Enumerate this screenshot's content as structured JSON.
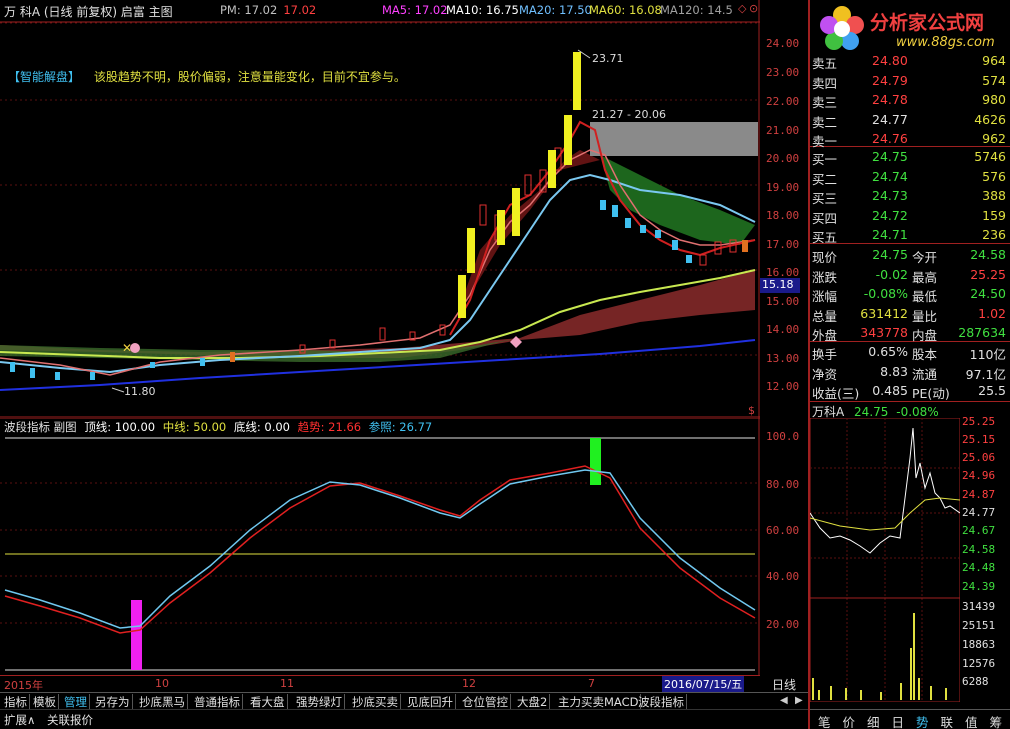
{
  "header": {
    "title": "万 科A (日线 前复权) 启富 主图",
    "pm_label": "PM: 17.02",
    "pm_value": "17.02",
    "ma5": "MA5: 17.02",
    "ma10": "MA10: 16.75",
    "ma20": "MA20: 17.50",
    "ma60": "MA60: 16.08",
    "ma120": "MA120: 14.5"
  },
  "watermark": {
    "name": "分析家公式网",
    "url": "www.88gs.com"
  },
  "smart_box": {
    "tag": "【智能解盘】",
    "text": "该股趋势不明，股价偏弱，注意量能变化，目前不宜参与。"
  },
  "annotations": {
    "high": "23.71",
    "range": "21.27 - 20.06",
    "low": "11.80",
    "cursor_price": "15.18"
  },
  "main_axis": [
    "24.00",
    "23.00",
    "22.00",
    "21.00",
    "20.00",
    "19.00",
    "18.00",
    "17.00",
    "16.00",
    "15.00",
    "14.00",
    "13.00",
    "12.00"
  ],
  "sub_header": {
    "name": "波段指标 副图",
    "top": "顶线: 100.00",
    "mid": "中线: 50.00",
    "bottom": "底线: 0.00",
    "trend": "趋势: 21.66",
    "ref": "参照: 26.77"
  },
  "sub_axis": [
    "100.0",
    "80.00",
    "60.00",
    "40.00",
    "20.00"
  ],
  "date_axis": {
    "labels": [
      "2015年",
      "10",
      "11",
      "12",
      "7"
    ],
    "current": "2016/07/15/五",
    "period": "日线"
  },
  "quotes": {
    "asks": [
      {
        "label": "卖五",
        "price": "24.80",
        "vol": "964"
      },
      {
        "label": "卖四",
        "price": "24.79",
        "vol": "574"
      },
      {
        "label": "卖三",
        "price": "24.78",
        "vol": "980"
      },
      {
        "label": "卖二",
        "price": "24.77",
        "vol": "4626"
      },
      {
        "label": "卖一",
        "price": "24.76",
        "vol": "962"
      }
    ],
    "bids": [
      {
        "label": "买一",
        "price": "24.75",
        "vol": "5746"
      },
      {
        "label": "买二",
        "price": "24.74",
        "vol": "576"
      },
      {
        "label": "买三",
        "price": "24.73",
        "vol": "388"
      },
      {
        "label": "买四",
        "price": "24.72",
        "vol": "159"
      },
      {
        "label": "买五",
        "price": "24.71",
        "vol": "236"
      }
    ],
    "stats": [
      {
        "l1": "现价",
        "v1": "24.75",
        "l2": "今开",
        "v2": "24.58"
      },
      {
        "l1": "涨跌",
        "v1": "-0.02",
        "l2": "最高",
        "v2": "25.25"
      },
      {
        "l1": "涨幅",
        "v1": "-0.08%",
        "l2": "最低",
        "v2": "24.50"
      },
      {
        "l1": "总量",
        "v1": "631412",
        "l2": "量比",
        "v2": "1.02"
      },
      {
        "l1": "外盘",
        "v1": "343778",
        "l2": "内盘",
        "v2": "287634"
      }
    ],
    "stats2": [
      {
        "l1": "换手",
        "v1": "0.65%",
        "l2": "股本",
        "v2": "110亿"
      },
      {
        "l1": "净资",
        "v1": "8.83",
        "l2": "流通",
        "v2": "97.1亿"
      },
      {
        "l1": "收益(三)",
        "v1": "0.485",
        "l2": "PE(动)",
        "v2": "25.5"
      }
    ]
  },
  "mini_chart": {
    "title": "万科A",
    "price": "24.75",
    "change": "-0.08%",
    "price_axis": [
      "25.25",
      "25.15",
      "25.06",
      "24.96",
      "24.87",
      "24.77",
      "24.67",
      "24.58",
      "24.48",
      "24.39"
    ],
    "vol_axis": [
      "31439",
      "25151",
      "18863",
      "12576",
      "6288"
    ]
  },
  "tabs": [
    "指标",
    "模板",
    "管理",
    "另存为",
    "抄底黑马",
    "普通指标",
    "看大盘",
    "强势绿灯",
    "抄底买卖",
    "见底回升",
    "仓位管控",
    "大盘2",
    "主力买卖MACD",
    "波段指标"
  ],
  "bottom_left": [
    "扩展∧",
    "关联报价"
  ],
  "bottom_right_tabs": [
    "笔",
    "价",
    "细",
    "日",
    "势",
    "联",
    "值",
    "筹"
  ]
}
